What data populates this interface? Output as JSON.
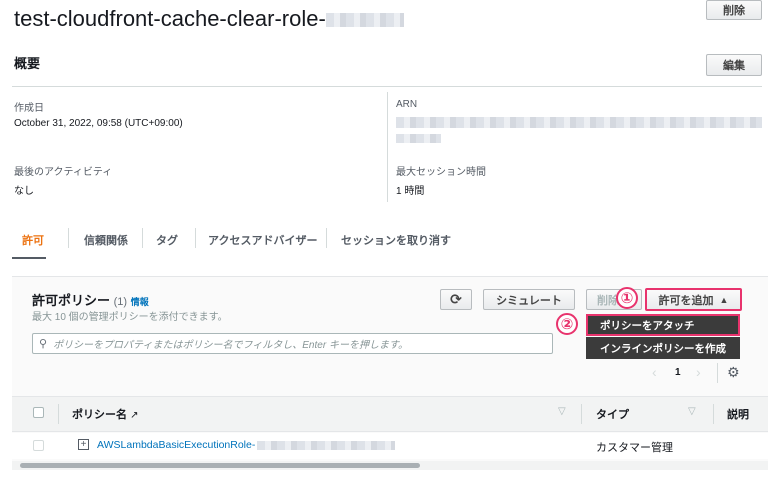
{
  "header": {
    "title": "test-cloudfront-cache-clear-role-",
    "delete_label": "削除"
  },
  "summary": {
    "heading": "概要",
    "edit_label": "編集",
    "created_label": "作成日",
    "created_value": "October 31, 2022, 09:58 (UTC+09:00)",
    "arn_label": "ARN",
    "last_activity_label": "最後のアクティビティ",
    "last_activity_value": "なし",
    "max_session_label": "最大セッション時間",
    "max_session_value": "1 時間"
  },
  "tabs": [
    {
      "label": "許可"
    },
    {
      "label": "信頼関係"
    },
    {
      "label": "タグ"
    },
    {
      "label": "アクセスアドバイザー"
    },
    {
      "label": "セッションを取り消す"
    }
  ],
  "policies": {
    "title": "許可ポリシー",
    "count": "(1)",
    "info": "情報",
    "subtitle": "最大 10 個の管理ポリシーを添付できます。",
    "simulate_label": "シミュレート",
    "delete_label": "削除",
    "add_label": "許可を追加",
    "menu": [
      {
        "label": "ポリシーをアタッチ"
      },
      {
        "label": "インラインポリシーを作成"
      }
    ],
    "search_placeholder": "ポリシーをプロパティまたはポリシー名でフィルタし、Enter キーを押します。",
    "page": "1",
    "columns": {
      "name": "ポリシー名",
      "type": "タイプ",
      "desc": "説明"
    },
    "rows": [
      {
        "name": "AWSLambdaBasicExecutionRole-",
        "type": "カスタマー管理"
      }
    ]
  },
  "annotations": {
    "one": "①",
    "two": "②"
  },
  "colors": {
    "accent": "#ec7211",
    "link": "#0073bb",
    "highlight": "#e8336d"
  }
}
